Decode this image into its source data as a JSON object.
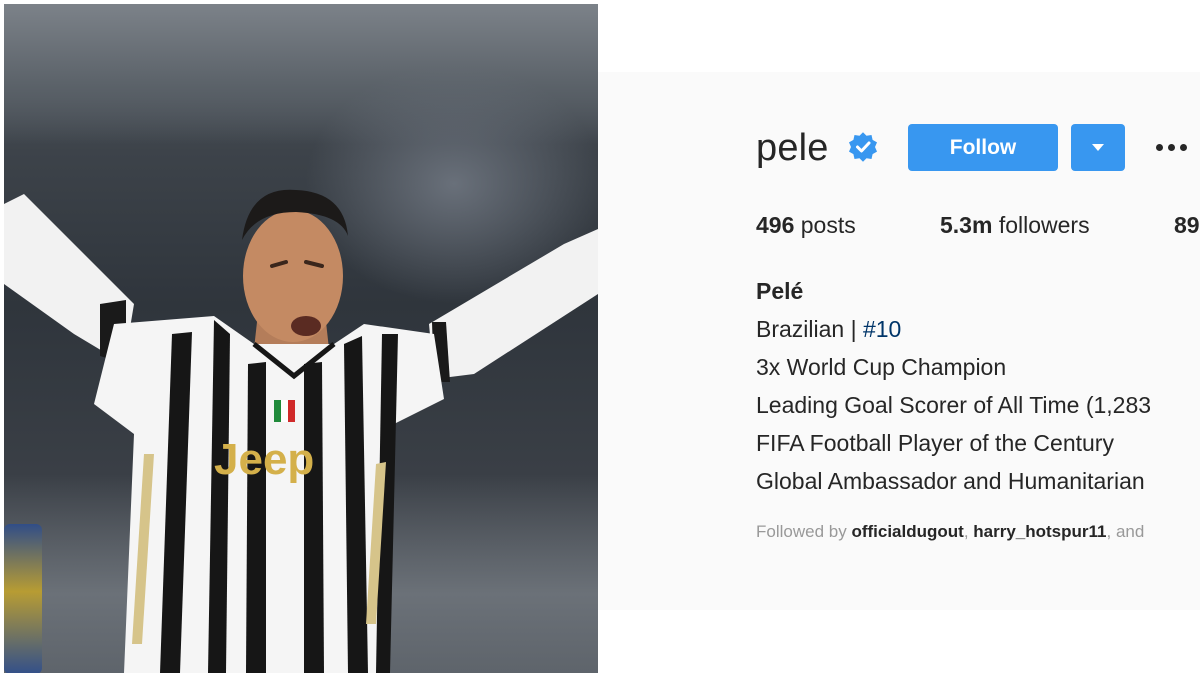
{
  "profile": {
    "username": "pele",
    "follow_label": "Follow",
    "stats": {
      "posts_count": "496",
      "posts_label": " posts",
      "followers_count": "5.3m",
      "followers_label": " followers",
      "following_partial": "89"
    },
    "bio": {
      "name": "Pelé",
      "line1_prefix": "Brazilian | ",
      "line1_tag": "#10",
      "line2": "3x World Cup Champion",
      "line3": "Leading Goal Scorer of All Time (1,283",
      "line4": "FIFA Football Player of the Century",
      "line5": "Global Ambassador and Humanitarian"
    },
    "followed_by": {
      "prefix": "Followed by ",
      "user1": "officialdugout",
      "sep1": ", ",
      "user2": "harry_hotspur11",
      "suffix": ", and"
    }
  },
  "icons": {
    "verified": "verified-badge-icon",
    "dropdown": "caret-down-icon",
    "more": "more-options-icon"
  },
  "colors": {
    "follow_button": "#3897f0",
    "verified_badge": "#3897f0",
    "hashtag": "#003569",
    "muted_text": "#999999",
    "text": "#262626"
  },
  "photo": {
    "jersey_text": "Jeep"
  }
}
